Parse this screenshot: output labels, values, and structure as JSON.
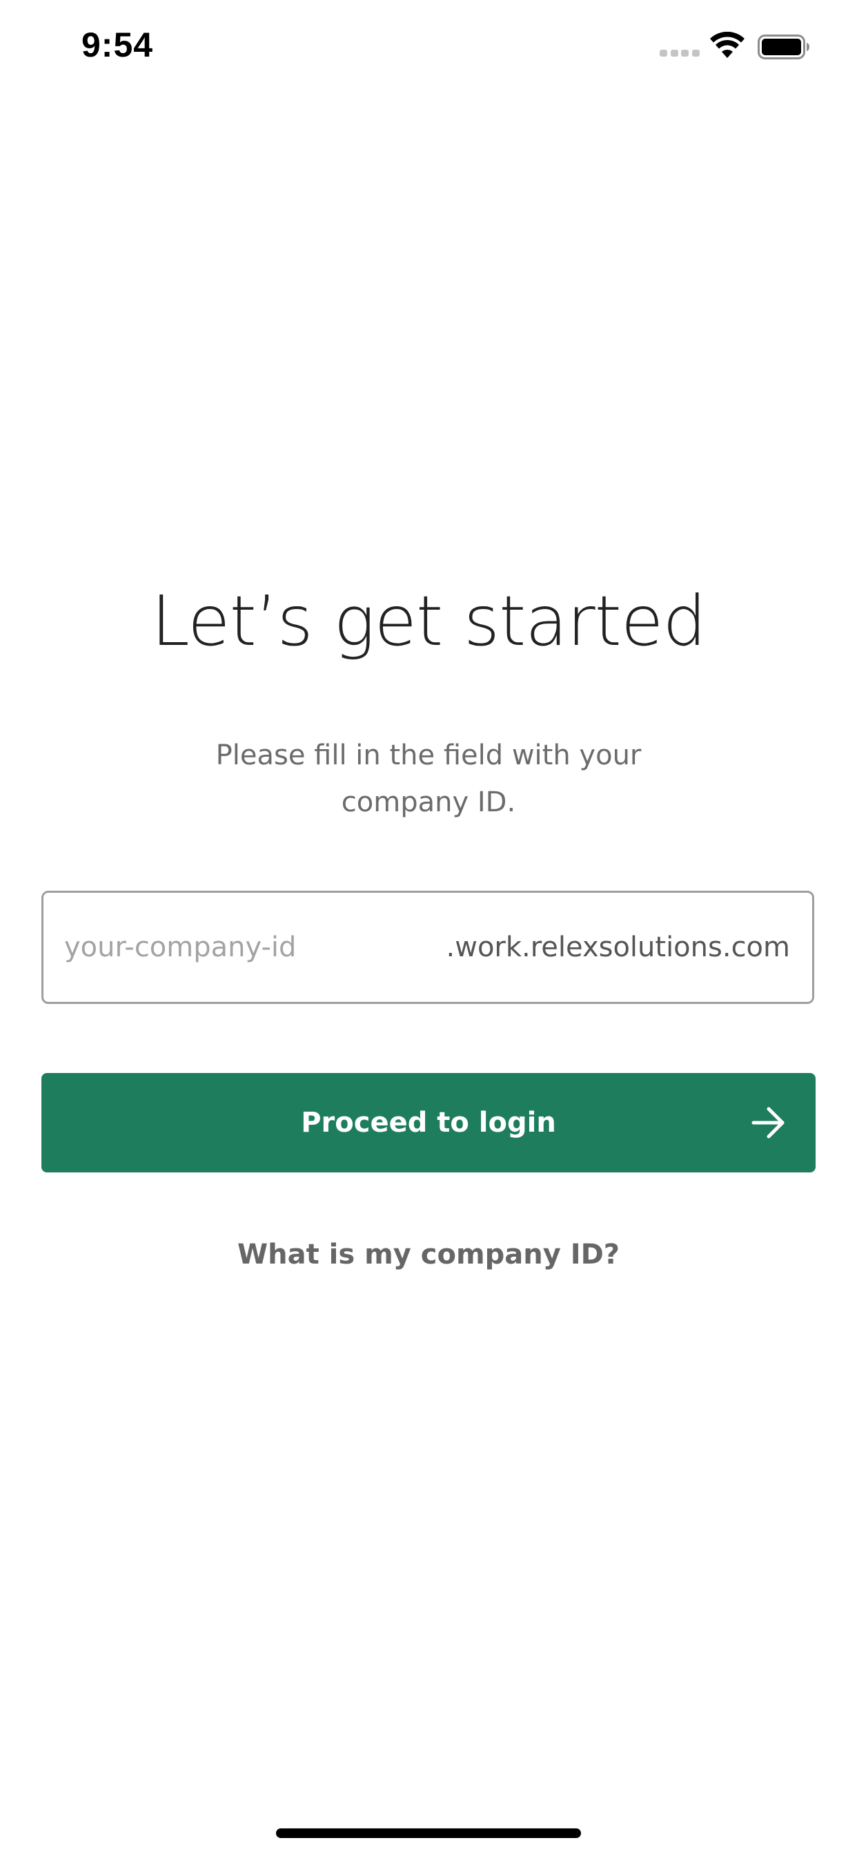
{
  "status_bar": {
    "time": "9:54",
    "icons": [
      "cellular-signal-icon",
      "wifi-icon",
      "battery-icon"
    ]
  },
  "main": {
    "heading": "Let’s get started",
    "subtitle": "Please fill in the field with your company ID.",
    "company_field": {
      "placeholder": "your-company-id",
      "value": "",
      "suffix": ".work.relexsolutions.com"
    },
    "proceed_button": {
      "label": "Proceed to login",
      "icon": "arrow-right-icon"
    },
    "help_link": "What is my company ID?"
  },
  "colors": {
    "primary": "#1e7d5c",
    "text_dark": "#222222",
    "text_muted": "#6b6b6b",
    "border": "#9e9e9e",
    "background": "#ffffff"
  }
}
